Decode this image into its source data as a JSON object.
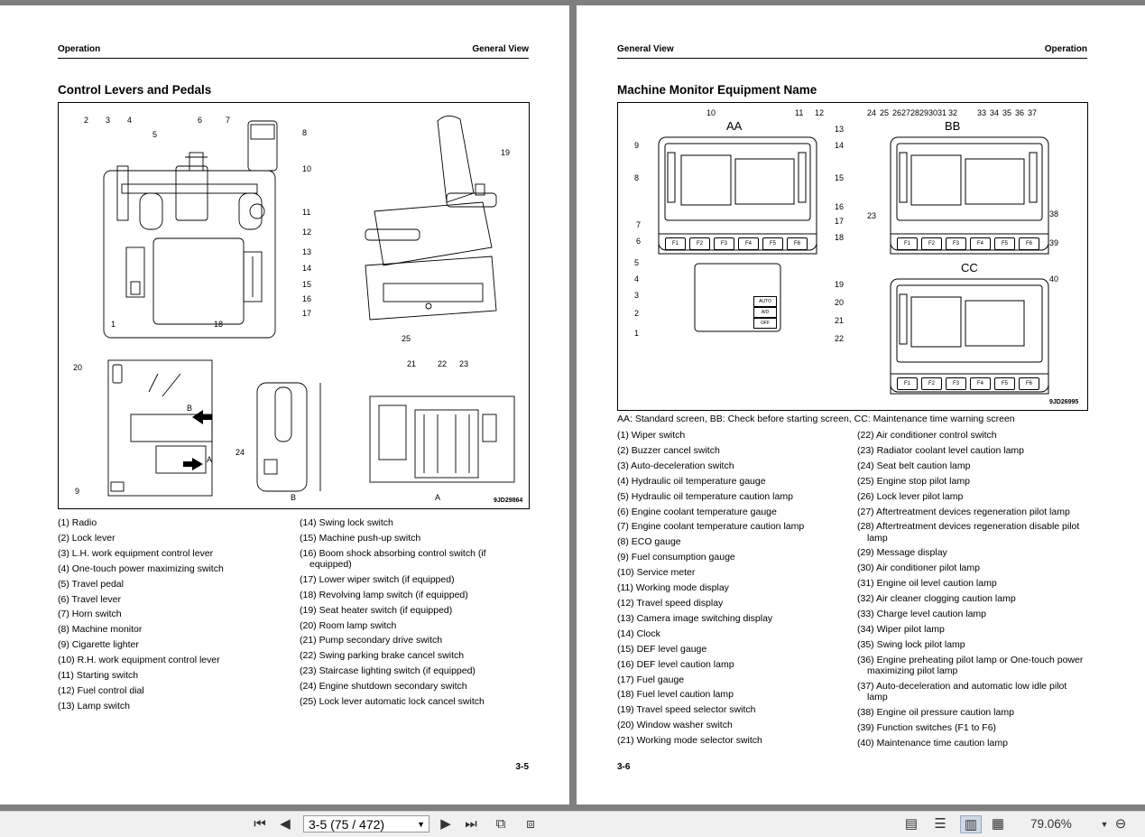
{
  "left_page": {
    "header_left": "Operation",
    "header_right": "General View",
    "title": "Control Levers and Pedals",
    "figure_code": "9JD29864",
    "figure_sublabels": {
      "b": "B",
      "a": "A",
      "b_arrow": "B",
      "a_arrow": "A"
    },
    "figure_callouts": [
      "1",
      "2",
      "3",
      "4",
      "5",
      "6",
      "7",
      "8",
      "9",
      "10",
      "11",
      "12",
      "13",
      "14",
      "15",
      "16",
      "17",
      "18",
      "19",
      "20",
      "21",
      "22",
      "23",
      "24",
      "25"
    ],
    "items_col1": [
      "(1) Radio",
      "(2) Lock lever",
      "(3) L.H. work equipment control lever",
      "(4) One-touch power maximizing switch",
      "(5) Travel pedal",
      "(6) Travel lever",
      "(7) Horn switch",
      "(8) Machine monitor",
      "(9) Cigarette lighter",
      "(10) R.H. work equipment control lever",
      "(11) Starting switch",
      "(12) Fuel control dial",
      "(13) Lamp switch"
    ],
    "items_col2": [
      "(14) Swing lock switch",
      "(15) Machine push-up switch",
      "(16) Boom shock absorbing control switch (if equipped)",
      "(17) Lower wiper switch (if equipped)",
      "(18) Revolving lamp switch (if equipped)",
      "(19) Seat heater switch (if equipped)",
      "(20) Room lamp switch",
      "(21) Pump secondary drive switch",
      "(22) Swing parking brake cancel switch",
      "(23) Staircase lighting switch (if equipped)",
      "(24) Engine shutdown secondary switch",
      "(25) Lock lever automatic lock cancel switch"
    ],
    "page_number": "3-5"
  },
  "right_page": {
    "header_left": "General View",
    "header_right": "Operation",
    "title": "Machine Monitor Equipment Name",
    "figure_code": "9JD26995",
    "screen_labels": {
      "aa": "AA",
      "bb": "BB",
      "cc": "CC"
    },
    "function_keys": [
      "F1",
      "F2",
      "F3",
      "F4",
      "F5",
      "F6"
    ],
    "switch_panel_labels": [
      "AUTO",
      "A/D",
      "OFF"
    ],
    "figure_callouts": [
      "1",
      "2",
      "3",
      "4",
      "5",
      "6",
      "7",
      "8",
      "9",
      "10",
      "11",
      "12",
      "13",
      "14",
      "15",
      "16",
      "17",
      "18",
      "19",
      "20",
      "21",
      "22",
      "23",
      "24",
      "25",
      "26",
      "27",
      "28",
      "29",
      "30",
      "31",
      "32",
      "33",
      "34",
      "35",
      "36",
      "37",
      "38",
      "39",
      "40"
    ],
    "caption": "AA: Standard screen, BB: Check before starting screen, CC: Maintenance time warning screen",
    "items_col1": [
      "(1) Wiper switch",
      "(2) Buzzer cancel switch",
      "(3) Auto-deceleration switch",
      "(4) Hydraulic oil temperature gauge",
      "(5) Hydraulic oil temperature caution lamp",
      "(6) Engine coolant temperature gauge",
      "(7) Engine coolant temperature caution lamp",
      "(8) ECO gauge",
      "(9) Fuel consumption gauge",
      "(10) Service meter",
      "(11) Working mode display",
      "(12) Travel speed display",
      "(13) Camera image switching display",
      "(14) Clock",
      "(15) DEF level gauge",
      "(16) DEF level caution lamp",
      "(17) Fuel gauge",
      "(18) Fuel level caution lamp",
      "(19) Travel speed selector switch",
      "(20) Window washer switch",
      "(21) Working mode selector switch"
    ],
    "items_col2": [
      "(22) Air conditioner control switch",
      "(23) Radiator coolant level caution lamp",
      "(24) Seat belt caution lamp",
      "(25) Engine stop pilot lamp",
      "(26) Lock lever pilot lamp",
      "(27) Aftertreatment devices regeneration pilot lamp",
      "(28) Aftertreatment devices regeneration disable pilot lamp",
      "(29) Message display",
      "(30) Air conditioner pilot lamp",
      "(31) Engine oil level caution lamp",
      "(32) Air cleaner clogging caution lamp",
      "(33) Charge level caution lamp",
      "(34) Wiper pilot lamp",
      "(35) Swing lock pilot lamp",
      "(36) Engine preheating pilot lamp or One-touch power maximizing pilot lamp",
      "(37) Auto-deceleration and automatic low idle pilot lamp",
      "(38) Engine oil pressure caution lamp",
      "(39) Function switches (F1 to F6)",
      "(40) Maintenance time caution lamp"
    ],
    "page_number": "3-6"
  },
  "toolbar": {
    "page_selector": "3-5 (75 / 472)",
    "zoom": "79.06%",
    "icons": [
      "first-page-icon",
      "previous-page-icon",
      "next-page-icon",
      "last-page-icon",
      "rotate-icon",
      "extract-icon",
      "single-page-view-icon",
      "continuous-view-icon",
      "two-page-view-icon",
      "two-page-continuous-view-icon",
      "zoom-dropdown-icon",
      "zoom-out-icon"
    ]
  }
}
